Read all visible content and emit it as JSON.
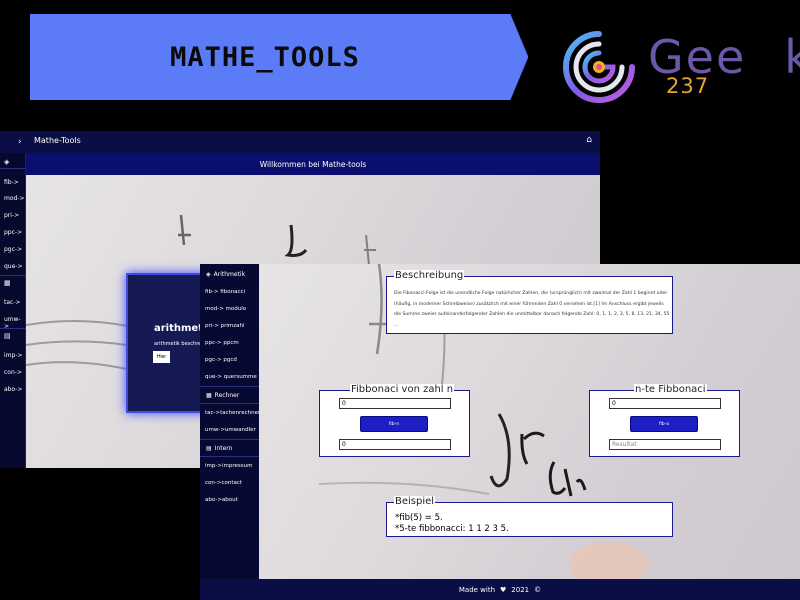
{
  "banner": {
    "title": "MATHE_TOOLS",
    "color": "#5b7cf6"
  },
  "logo": {
    "word_g": "G",
    "word_rest": "ee",
    "word_k": "k",
    "number": "237"
  },
  "back": {
    "title": "Mathe-Tools",
    "welcome": "Willkommen bei Mathe-tools",
    "sidebar": [
      "fib->",
      "mod->",
      "pri->",
      "ppc->",
      "pgc->",
      "que->",
      "tac->",
      "umw->",
      "imp->",
      "con->",
      "abo->"
    ],
    "card": {
      "title": "arithmetik",
      "subtitle": "arithmetik beschreib",
      "button": "Hier"
    }
  },
  "front": {
    "sidebar": {
      "sections": [
        {
          "heading": "Arithmetik",
          "icon": "layers-icon",
          "items": [
            "fib-> fibonacci",
            "mod-> modulo",
            "pri-> primzahl",
            "ppc-> ppcm",
            "pgc-> pgcd",
            "que-> quersumme"
          ]
        },
        {
          "heading": "Rechner",
          "icon": "calculator-icon",
          "items": [
            "tac->tachenrechner",
            "umw->umwandler"
          ]
        },
        {
          "heading": "Intern",
          "icon": "building-icon",
          "items": [
            "imp->impressum",
            "con->contact",
            "abo->about"
          ]
        }
      ]
    },
    "beschreibung": {
      "legend": "Beschreibung",
      "text": "Die Fibonacci-Folge ist die unendliche Folge natürlicher Zahlen, die (ursprünglich) mit zweimal der Zahl 1 beginnt oder (häufig, in moderner Schreibweise) zusätzlich mit einer führenden Zahl 0 versehen ist.[1] Im Anschluss ergibt jeweils die Summe zweier aufeinanderfolgender Zahlen die unmittelbar danach folgende Zahl: 0, 1, 1, 2, 3, 5, 8, 13, 21, 34, 55 ..."
    },
    "fib_von_zahl": {
      "legend": "Fibbonaci von zahl n",
      "input": "0",
      "button": "fib-n",
      "output": "0"
    },
    "nte_fib": {
      "legend": "n-te Fibbonaci",
      "input": "0",
      "button": "fib-a",
      "output_placeholder": "Resultat"
    },
    "beispiel": {
      "legend": "Beispiel",
      "line1": "*fib(5) = 5.",
      "line2": "*5-te fibbonacci: 1 1 2 3 5."
    },
    "footer": {
      "made_with": "Made with",
      "year": "2021"
    }
  }
}
